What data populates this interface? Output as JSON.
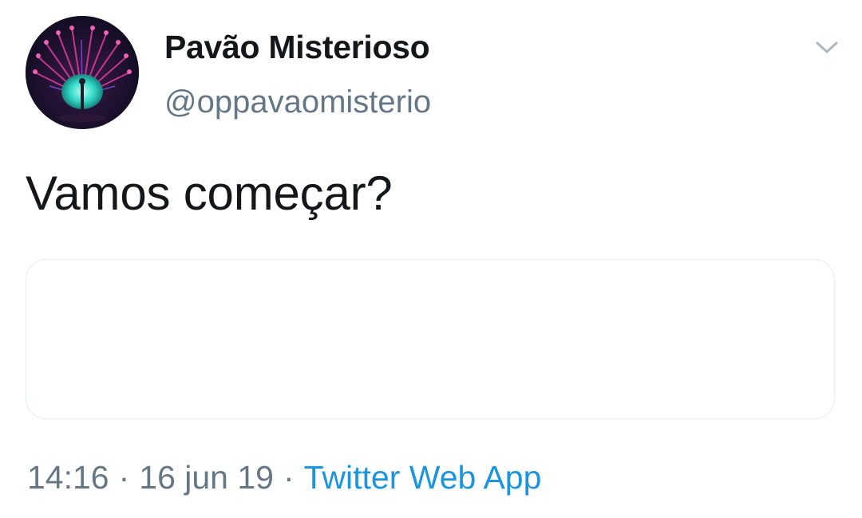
{
  "user": {
    "display_name": "Pavão Misterioso",
    "handle": "@oppavaomisterio",
    "avatar_icon": "peacock-avatar"
  },
  "tweet": {
    "text": "Vamos começar?"
  },
  "meta": {
    "time": "14:16",
    "separator": "·",
    "date": "16 jun 19",
    "source": "Twitter Web App"
  },
  "colors": {
    "text_primary": "#14171a",
    "text_secondary": "#657786",
    "link": "#1b95e0",
    "card_border": "#e6ecf0"
  }
}
